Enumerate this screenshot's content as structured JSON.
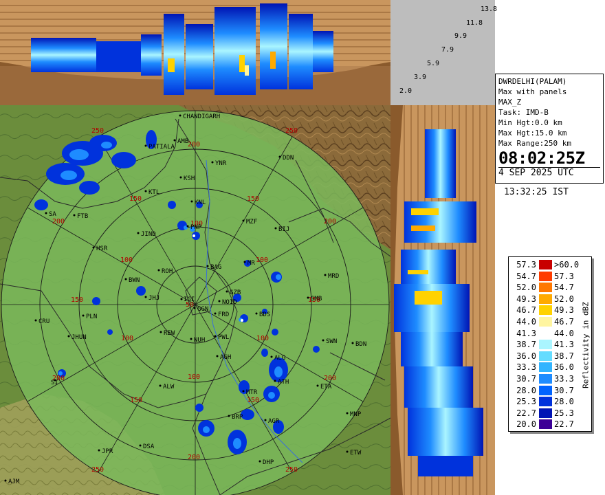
{
  "info": {
    "station": "DWRDELHI(PALAM)",
    "product": "Max with panels",
    "type": "MAX_Z",
    "task": "Task: IMD-B",
    "min_hgt": "Min Hgt:0.0 km",
    "max_hgt": "Max Hgt:15.0 km",
    "max_range": "Max Range:250 km",
    "time_utc": "08:02:25Z",
    "date_utc": "4 SEP 2025 UTC",
    "time_ist": "13:32:25 IST"
  },
  "height_scale": [
    "13.8",
    "11.8",
    "9.9",
    "7.9",
    "5.9",
    "3.9",
    "2.0"
  ],
  "legend": {
    "title": "Reflectivity in dBZ",
    "rows": [
      {
        "lo": "57.3",
        "hi": ">60.0",
        "color": "#c80000"
      },
      {
        "lo": "54.7",
        "hi": "57.3",
        "color": "#ff3c00"
      },
      {
        "lo": "52.0",
        "hi": "54.7",
        "color": "#ff7800"
      },
      {
        "lo": "49.3",
        "hi": "52.0",
        "color": "#ffaa00"
      },
      {
        "lo": "46.7",
        "hi": "49.3",
        "color": "#ffd200"
      },
      {
        "lo": "44.0",
        "hi": "46.7",
        "color": "#fff5a0"
      },
      {
        "lo": "41.3",
        "hi": "44.0",
        "color": "#ffffff"
      },
      {
        "lo": "38.7",
        "hi": "41.3",
        "color": "#aaf5ff"
      },
      {
        "lo": "36.0",
        "hi": "38.7",
        "color": "#64dcff"
      },
      {
        "lo": "33.3",
        "hi": "36.0",
        "color": "#32b4ff"
      },
      {
        "lo": "30.7",
        "hi": "33.3",
        "color": "#1e8cff"
      },
      {
        "lo": "28.0",
        "hi": "30.7",
        "color": "#0064ff"
      },
      {
        "lo": "25.3",
        "hi": "28.0",
        "color": "#0032dc"
      },
      {
        "lo": "22.7",
        "hi": "25.3",
        "color": "#0014b4"
      },
      {
        "lo": "20.0",
        "hi": "22.7",
        "color": "#3c0096"
      }
    ]
  },
  "range_labels": {
    "r50": "50",
    "r100": "100",
    "r150": "150",
    "r200": "200",
    "r250": "250"
  },
  "cities": {
    "chandigarh": "CHANDIGARH",
    "patiala": "PATIALA",
    "amb": "AMB",
    "ddn": "DDN",
    "ynr": "YNR",
    "ksh": "KSH",
    "ktl": "KTL",
    "knl": "KNL",
    "sa": "SA",
    "ftb": "FTB",
    "jind": "JIND",
    "pnp": "PNP",
    "mzf": "MZF",
    "bij": "BIJ",
    "hsr": "HSR",
    "roh": "ROH",
    "bag": "BAG",
    "mr": "MR",
    "mrd": "MRD",
    "bwn": "BWN",
    "jhj": "JHJ",
    "ggn": "GGN",
    "igi": "IGI",
    "noid": "NOID",
    "gzb": "GZB",
    "frd": "FRD",
    "smb": "SMB",
    "bds": "BDS",
    "cru": "CRU",
    "pln": "PLN",
    "rew": "REW",
    "nuh": "NUH",
    "pwl": "PWL",
    "jhun": "JHUN",
    "swn": "SWN",
    "bdn": "BDN",
    "agh": "AGH",
    "alg": "ALG",
    "ath": "ATH",
    "si": "SI",
    "alw": "ALW",
    "mtr": "MTR",
    "eta": "ETA",
    "brp": "BRP",
    "agr": "AGR",
    "mnp": "MNP",
    "jpr": "JPR",
    "dsa": "DSA",
    "dhp": "DHP",
    "etw": "ETW",
    "ajm": "AJM"
  }
}
